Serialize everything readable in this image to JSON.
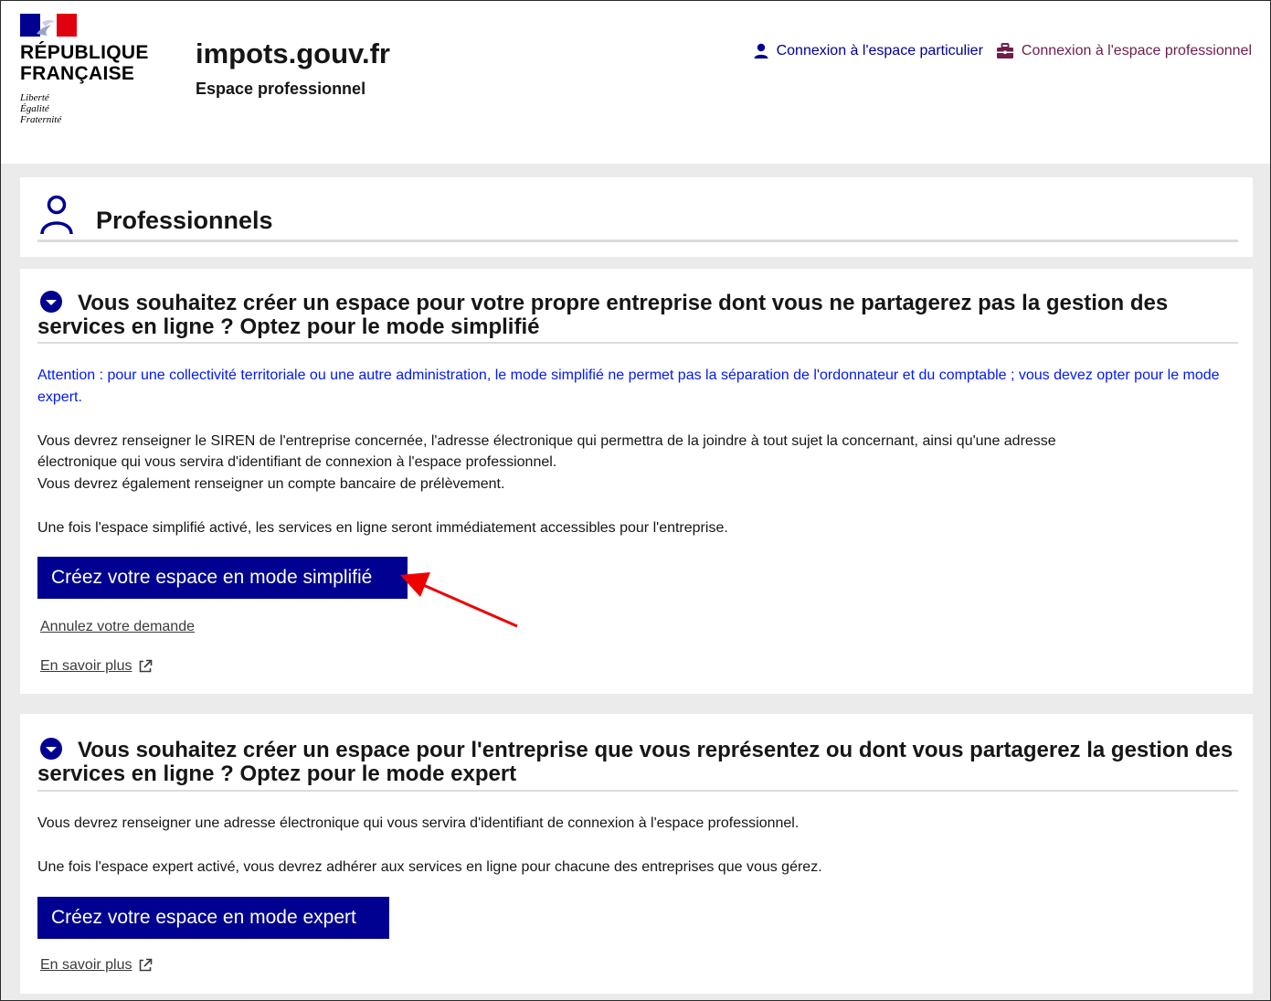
{
  "header": {
    "logo": {
      "line1": "RÉPUBLIQUE",
      "line2": "FRANÇAISE",
      "motto1": "Liberté",
      "motto2": "Égalité",
      "motto3": "Fraternité"
    },
    "site_name": "impots.gouv.fr",
    "site_tagline": "Espace professionnel",
    "links": {
      "particulier": "Connexion à l'espace particulier",
      "professionnel": "Connexion à l'espace professionnel"
    }
  },
  "page_title": "Professionnels",
  "section_simple": {
    "heading": "Vous souhaitez créer un espace pour votre propre entreprise dont vous ne partagerez pas la gestion des services en ligne ? Optez pour le mode simplifié",
    "warning": "Attention : pour une collectivité territoriale ou une autre administration, le mode simplifié ne permet pas la séparation de l'ordonnateur et du comptable ; vous devez opter pour le mode expert.",
    "para1_line1": "Vous devrez renseigner le SIREN de l'entreprise concernée, l'adresse électronique qui permettra de la joindre à tout sujet la concernant, ainsi qu'une adresse",
    "para1_line2": "électronique qui vous servira d'identifiant de connexion à l'espace professionnel.",
    "para1_line3": "Vous devrez également renseigner un compte bancaire de prélèvement.",
    "para2": "Une fois l'espace simplifié activé, les services en ligne seront immédiatement accessibles pour l'entreprise.",
    "button": "Créez votre espace en mode simplifié",
    "cancel_link": "Annulez votre demande",
    "more_link": "En savoir plus"
  },
  "section_expert": {
    "heading": "Vous souhaitez créer un espace pour l'entreprise que vous représentez ou dont vous partagerez la gestion des services en ligne ? Optez pour le mode expert",
    "para1": "Vous devrez renseigner une adresse électronique qui vous servira d'identifiant de connexion à l'espace professionnel.",
    "para2": "Une fois l'espace expert activé, vous devrez adhérer aux services en ligne pour chacune des entreprises que vous gérez.",
    "button": "Créez votre espace en mode expert",
    "more_link": "En savoir plus"
  },
  "colors": {
    "primary_blue": "#000091",
    "warning_blue": "#0018ff",
    "pro_link": "#6e1d4b",
    "flag_red": "#e1000f",
    "annotation_arrow": "#ee0000"
  }
}
